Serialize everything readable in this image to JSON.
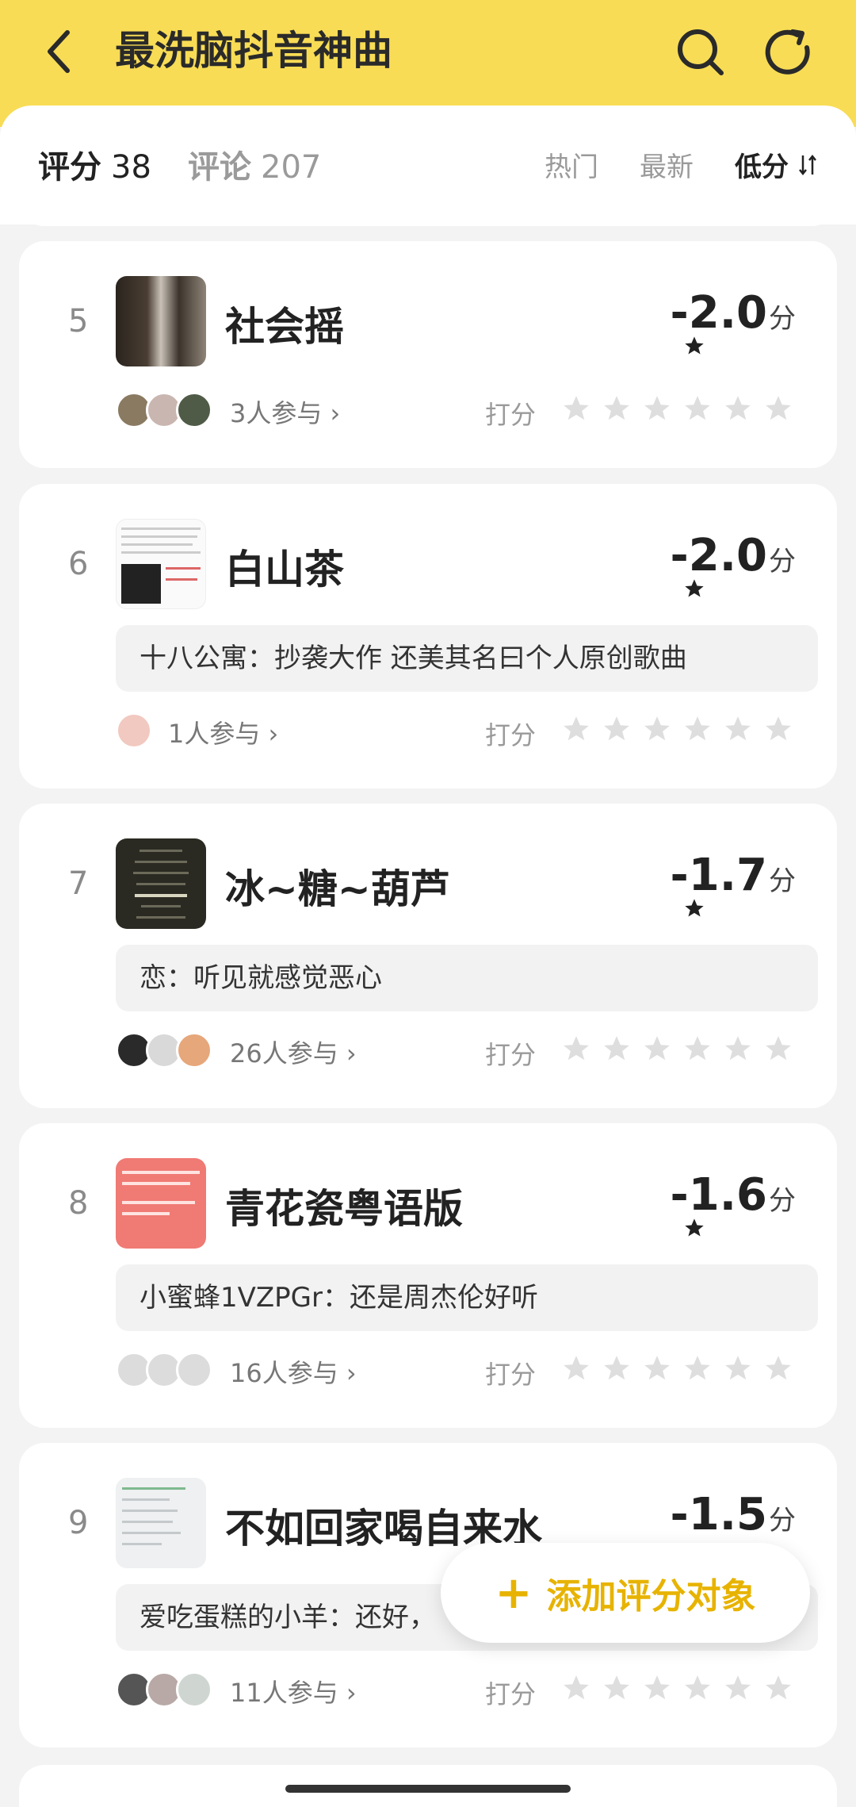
{
  "header": {
    "title": "最洗脑抖音神曲"
  },
  "tabs": {
    "score_label": "评分",
    "score_count": "38",
    "comment_label": "评论",
    "comment_count": "207"
  },
  "sort": {
    "hot": "热门",
    "new": "最新",
    "low": "低分"
  },
  "common": {
    "rate_label": "打分",
    "score_unit": "分"
  },
  "items": [
    {
      "rank": "5",
      "name": "社会摇",
      "score": "-2.0",
      "participants": "3人参与",
      "comment_user": "",
      "comment_text": ""
    },
    {
      "rank": "6",
      "name": "白山茶",
      "score": "-2.0",
      "participants": "1人参与",
      "comment_user": "十八公寓：",
      "comment_text": "抄袭大作 还美其名曰个人原创歌曲"
    },
    {
      "rank": "7",
      "name": "冰~糖~葫芦",
      "score": "-1.7",
      "participants": "26人参与",
      "comment_user": "恋：",
      "comment_text": "听见就感觉恶心"
    },
    {
      "rank": "8",
      "name": "青花瓷粤语版",
      "score": "-1.6",
      "participants": "16人参与",
      "comment_user": "小蜜蜂1VZPGr：",
      "comment_text": "还是周杰伦好听"
    },
    {
      "rank": "9",
      "name": "不如回家喝自来水",
      "score": "-1.5",
      "participants": "11人参与",
      "comment_user": "爱吃蛋糕的小羊：",
      "comment_text": "还好，"
    }
  ],
  "fab": {
    "plus": "+",
    "label": "添加评分对象"
  },
  "colors": {
    "header": "#f8dc55",
    "accent": "#e7b300"
  }
}
